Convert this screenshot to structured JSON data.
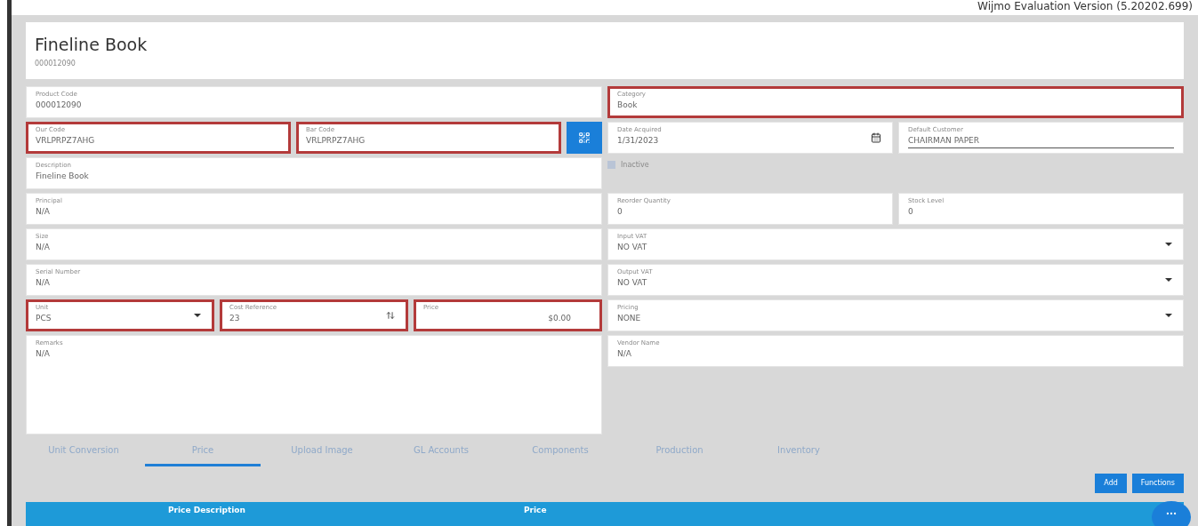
{
  "banner": "Wijmo Evaluation Version (5.20202.699)",
  "header": {
    "title": "Fineline Book",
    "subtitle": "000012090"
  },
  "left_rows": [
    [
      {
        "kind": "text",
        "label": "Product Code",
        "value": "000012090",
        "highlighted": false
      }
    ],
    [
      {
        "kind": "text",
        "label": "Our Code",
        "value": "VRLPRPZ7AHG",
        "highlighted": true
      },
      {
        "kind": "text",
        "label": "Bar Code",
        "value": "VRLPRPZ7AHG",
        "highlighted": true
      },
      {
        "kind": "scan"
      }
    ],
    [
      {
        "kind": "text",
        "label": "Description",
        "value": "Fineline Book",
        "highlighted": false
      }
    ],
    [
      {
        "kind": "text",
        "label": "Principal",
        "value": "N/A",
        "highlighted": false
      }
    ],
    [
      {
        "kind": "text",
        "label": "Size",
        "value": "N/A",
        "highlighted": false
      }
    ],
    [
      {
        "kind": "text",
        "label": "Serial Number",
        "value": "N/A",
        "highlighted": false
      }
    ],
    [
      {
        "kind": "select",
        "label": "Unit",
        "value": "PCS",
        "highlighted": true
      },
      {
        "kind": "spin",
        "label": "Cost Reference",
        "value": "23",
        "highlighted": true
      },
      {
        "kind": "number",
        "label": "Price",
        "value": "$0.00",
        "highlighted": true
      }
    ],
    [
      {
        "kind": "textarea",
        "label": "Remarks",
        "value": "N/A",
        "highlighted": false
      }
    ]
  ],
  "right_rows": [
    [
      {
        "kind": "text",
        "label": "Category",
        "value": "Book",
        "highlighted": true
      }
    ],
    [
      {
        "kind": "date",
        "label": "Date Acquired",
        "value": "1/31/2023",
        "highlighted": false
      },
      {
        "kind": "underline",
        "label": "Default Customer",
        "value": "CHAIRMAN PAPER",
        "highlighted": false
      }
    ],
    [
      {
        "kind": "checkbox",
        "label": "Inactive",
        "checked": false
      }
    ],
    [
      {
        "kind": "text",
        "label": "Reorder Quantity",
        "value": "0",
        "highlighted": false
      },
      {
        "kind": "text",
        "label": "Stock Level",
        "value": "0",
        "highlighted": false
      }
    ],
    [
      {
        "kind": "select",
        "label": "Input VAT",
        "value": "NO VAT",
        "highlighted": false
      }
    ],
    [
      {
        "kind": "select",
        "label": "Output VAT",
        "value": "NO VAT",
        "highlighted": false
      }
    ],
    [
      {
        "kind": "select",
        "label": "Pricing",
        "value": "NONE",
        "highlighted": false
      }
    ],
    [
      {
        "kind": "text",
        "label": "Vendor Name",
        "value": "N/A",
        "highlighted": false
      }
    ]
  ],
  "tabs": [
    {
      "label": "Unit Conversion",
      "selected": false
    },
    {
      "label": "Price",
      "selected": true
    },
    {
      "label": "Upload Image",
      "selected": false
    },
    {
      "label": "GL Accounts",
      "selected": false
    },
    {
      "label": "Components",
      "selected": false
    },
    {
      "label": "Production",
      "selected": false
    },
    {
      "label": "Inventory",
      "selected": false
    }
  ],
  "buttons": [
    "Add",
    "Functions"
  ],
  "table": {
    "columns": [
      "Price Description",
      "Price"
    ]
  }
}
